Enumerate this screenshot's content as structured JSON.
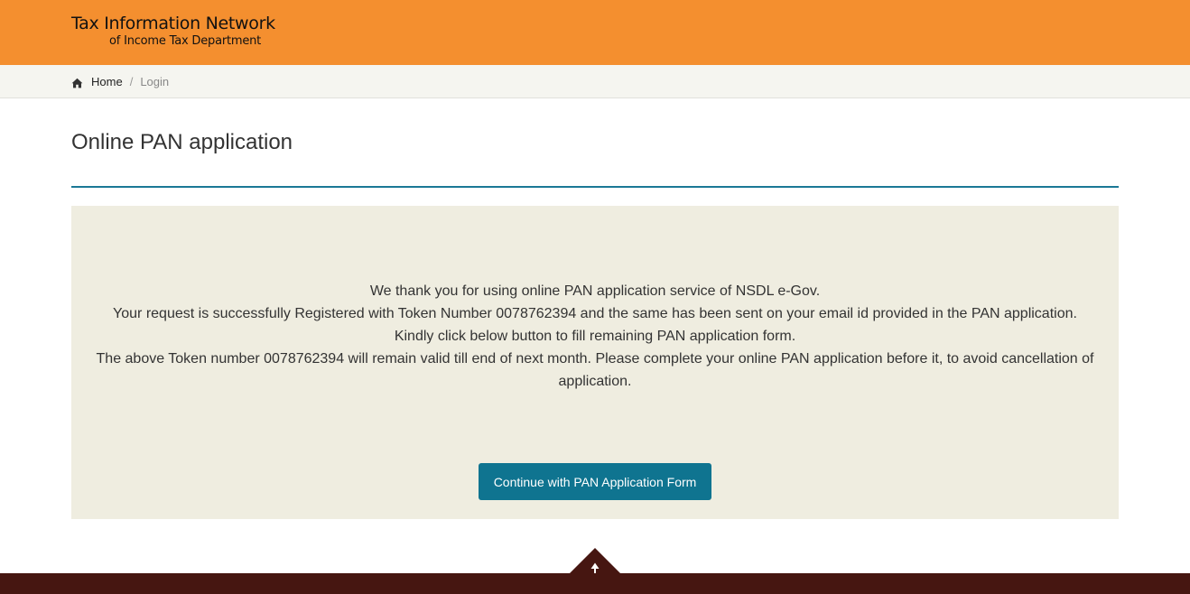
{
  "header": {
    "logo_line1": "Tax Information Network",
    "logo_line2": "of Income Tax Department",
    "background_color": "#f48f2f"
  },
  "breadcrumb": {
    "icon": "home-icon",
    "items": [
      {
        "label": "Home"
      },
      {
        "label": "Login"
      }
    ],
    "separator": "/"
  },
  "page": {
    "title": "Online PAN application",
    "accent_color": "#1b7896"
  },
  "message": {
    "lines": [
      "We thank you for using online PAN application service of NSDL e-Gov.",
      "Your request is successfully Registered with Token Number 0078762394 and the same has been sent on your email id provided in the PAN application.",
      "Kindly click below button to fill remaining PAN application form.",
      "The above Token number 0078762394 will remain valid till end of next month. Please complete your online PAN application before it, to avoid cancellation of application."
    ],
    "panel_color": "#efede0"
  },
  "actions": {
    "continue_label": "Continue with PAN Application Form",
    "button_color": "#0f7490"
  },
  "footer": {
    "scroll_top_icon": "arrow-up-icon",
    "background_color": "#461611"
  }
}
